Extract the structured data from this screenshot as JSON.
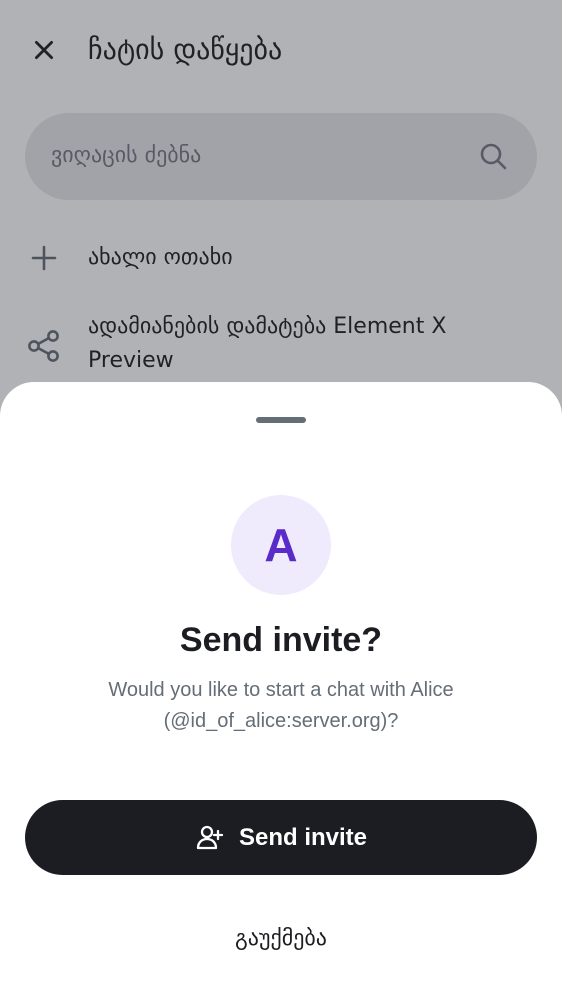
{
  "header": {
    "title": "ჩატის დაწყება",
    "close_icon": "close-icon"
  },
  "search": {
    "placeholder": "ვიღაცის ძებნა",
    "icon": "search-icon"
  },
  "actions": [
    {
      "label": "ახალი ოთახი",
      "icon": "plus-icon"
    },
    {
      "label": "ადამიანების დამატება Element X Preview",
      "icon": "share-icon"
    }
  ],
  "sheet": {
    "avatar_letter": "A",
    "title": "Send invite?",
    "body": "Would you like to start a chat with Alice (@id_of_alice:server.org)?",
    "primary_label": "Send invite",
    "primary_icon": "user-add-icon",
    "cancel_label": "გაუქმება"
  },
  "colors": {
    "accent": "#5a2bc9",
    "avatar_bg": "#efebfd",
    "primary_button": "#1b1d22",
    "secondary_text": "#656d77"
  }
}
